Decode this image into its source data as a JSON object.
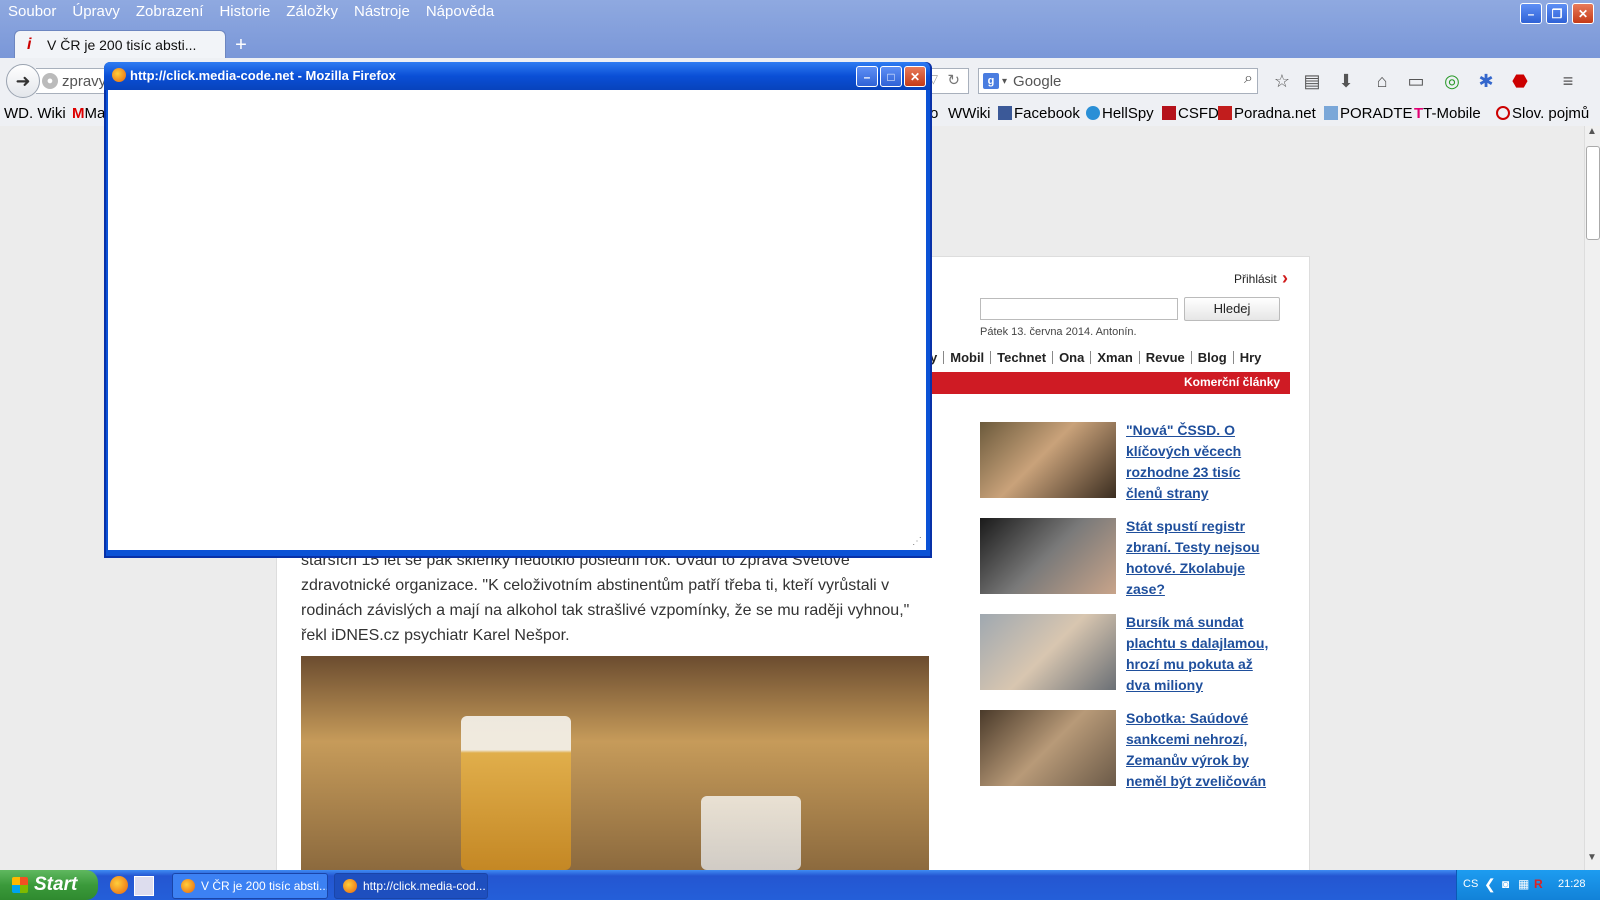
{
  "menubar": {
    "items": [
      "Soubor",
      "Úpravy",
      "Zobrazení",
      "Historie",
      "Záložky",
      "Nástroje",
      "Nápověda"
    ]
  },
  "tab": {
    "title": "V ČR je 200 tisíc absti...",
    "favicon": "i"
  },
  "navigation": {
    "url_text": "zpravy",
    "search_placeholder": "Google"
  },
  "bookmarks": {
    "left": [
      {
        "label": "WD. Wiki",
        "icon": "wd-icon"
      },
      {
        "label": "Ma",
        "icon": "m-icon"
      }
    ],
    "right": [
      {
        "label": "o",
        "icon": ""
      },
      {
        "label": "Wiki",
        "icon": "wikipedia-icon"
      },
      {
        "label": "Facebook",
        "icon": "facebook-icon"
      },
      {
        "label": "HellSpy",
        "icon": "hellspy-icon"
      },
      {
        "label": "CSFD",
        "icon": "csfd-icon"
      },
      {
        "label": "Poradna.net",
        "icon": "poradna-icon"
      },
      {
        "label": "PORADTE",
        "icon": "poradte-icon"
      },
      {
        "label": "T-Mobile",
        "icon": "tmobile-icon"
      },
      {
        "label": "Slov. pojmů",
        "icon": "slovnik-icon"
      }
    ]
  },
  "site": {
    "login": "Přihlásit",
    "search_button": "Hledej",
    "date": "Pátek 13. června 2014. Antonín.",
    "nav": [
      "y",
      "Mobil",
      "Technet",
      "Ona",
      "Xman",
      "Revue",
      "Blog",
      "Hry"
    ],
    "commercial": "Komerční články",
    "news": [
      {
        "headline": "\"Nová\" ČSSD. O klíčových věcech rozhodne 23 tisíc členů strany"
      },
      {
        "headline": "Stát spustí registr zbraní. Testy nejsou hotové. Zkolabuje zase?"
      },
      {
        "headline": "Bursík má sundat plachtu s dalajlamou, hrozí mu pokuta až dva miliony"
      },
      {
        "headline": "Sobotka: Saúdové sankcemi nehrozí, Zemanův výrok by neměl být zveličován"
      }
    ],
    "body_text": "starších 15 let se pak sklenky nedotklo poslední rok. Uvádí to zpráva Světové zdravotnické organizace. \"K celoživotním abstinentům patří třeba ti, kteří vyrůstali v rodinách závislých a mají na alkohol tak strašlivé vzpomínky, že se mu raději vyhnou,\" řekl iDNES.cz psychiatr Karel Nešpor."
  },
  "popup": {
    "title": "http://click.media-code.net - Mozilla Firefox"
  },
  "taskbar": {
    "start": "Start",
    "items": [
      "V ČR je 200 tisíc absti...",
      "http://click.media-cod..."
    ],
    "tray_lang": "CS",
    "clock": "21:28"
  },
  "colors": {
    "accent_red": "#cf1b24",
    "link_blue": "#1f4f9c",
    "xp_blue": "#0b52d6",
    "taskbar_blue": "#245fd9",
    "start_green": "#3b9a3b"
  }
}
